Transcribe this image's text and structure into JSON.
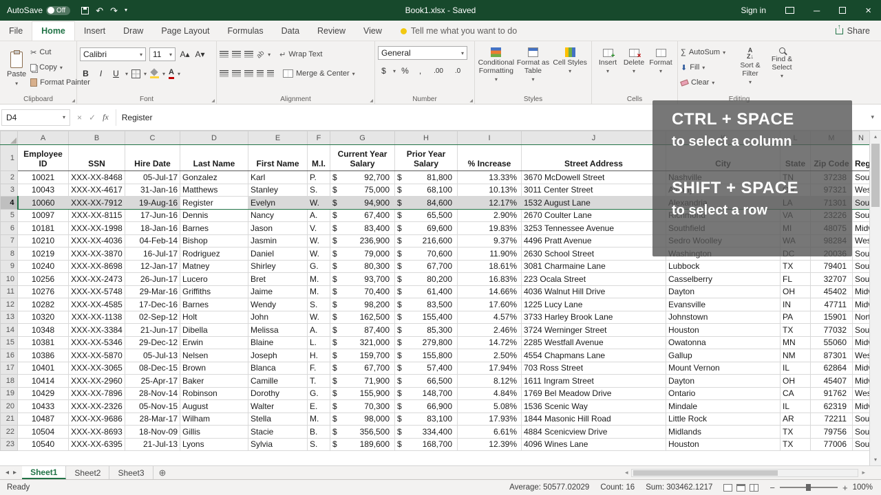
{
  "colors": {
    "excel_green": "#217346",
    "titlebar_green": "#17492c",
    "selected_row_fill": "#d9d9d9",
    "overlay_bg": "rgba(85,85,85,0.8)"
  },
  "titlebar": {
    "autosave_label": "AutoSave",
    "autosave_state": "Off",
    "title": "Book1.xlsx  -  Saved",
    "sign_in": "Sign in"
  },
  "tabs": {
    "items": [
      "File",
      "Home",
      "Insert",
      "Draw",
      "Page Layout",
      "Formulas",
      "Data",
      "Review",
      "View"
    ],
    "active": "Home",
    "tell_me": "Tell me what you want to do",
    "share": "Share"
  },
  "ribbon": {
    "clipboard": {
      "label": "Clipboard",
      "paste": "Paste",
      "cut": "Cut",
      "copy": "Copy",
      "format_painter": "Format Painter"
    },
    "font": {
      "label": "Font",
      "font_name": "Calibri",
      "font_size": "11",
      "bold": "B",
      "italic": "I",
      "underline": "U"
    },
    "alignment": {
      "label": "Alignment",
      "wrap_text": "Wrap Text",
      "merge_center": "Merge & Center"
    },
    "number": {
      "label": "Number",
      "format": "General",
      "dollar": "$",
      "percent": "%",
      "comma": ",",
      "inc_dec": ".00",
      "dec_dec": ".0"
    },
    "styles": {
      "label": "Styles",
      "conditional": "Conditional Formatting",
      "format_table": "Format as Table",
      "cell_styles": "Cell Styles"
    },
    "cells": {
      "label": "Cells",
      "insert": "Insert",
      "delete": "Delete",
      "format": "Format"
    },
    "editing": {
      "label": "Editing",
      "autosum": "AutoSum",
      "fill": "Fill",
      "clear": "Clear",
      "sort_filter": "Sort & Filter",
      "find_select": "Find & Select"
    }
  },
  "formula_bar": {
    "name_box": "D4",
    "fx_label": "fx",
    "content": "Register"
  },
  "overlay": {
    "line1": "CTRL + SPACE",
    "line2": "to select a column",
    "line3": "SHIFT + SPACE",
    "line4": "to select a row"
  },
  "sheet": {
    "col_letters": [
      "A",
      "B",
      "C",
      "D",
      "E",
      "F",
      "G",
      "H",
      "I",
      "J",
      "K",
      "L",
      "M",
      "N"
    ],
    "headers": [
      "Employee ID",
      "SSN",
      "Hire Date",
      "Last Name",
      "First Name",
      "M.I.",
      "Current Year Salary",
      "Prior Year Salary",
      "% Increase",
      "Street Address",
      "City",
      "State",
      "Zip Code",
      "Region"
    ],
    "currency": "$",
    "selected_row": 4,
    "active_col": "D",
    "rows": [
      [
        "10021",
        "XXX-XX-8468",
        "05-Jul-17",
        "Gonzalez",
        "Karl",
        "P.",
        "92,700",
        "81,800",
        "13.33%",
        "3670 McDowell Street",
        "Nashville",
        "TN",
        "37238",
        "South"
      ],
      [
        "10043",
        "XXX-XX-4617",
        "31-Jan-16",
        "Matthews",
        "Stanley",
        "S.",
        "75,000",
        "68,100",
        "10.13%",
        "3011 Center Street",
        "Albany",
        "OR",
        "97321",
        "West"
      ],
      [
        "10060",
        "XXX-XX-7912",
        "19-Aug-16",
        "Register",
        "Evelyn",
        "W.",
        "94,900",
        "84,600",
        "12.17%",
        "1532 August Lane",
        "Alexandria",
        "LA",
        "71301",
        "South"
      ],
      [
        "10097",
        "XXX-XX-8115",
        "17-Jun-16",
        "Dennis",
        "Nancy",
        "A.",
        "67,400",
        "65,500",
        "2.90%",
        "2670 Coulter Lane",
        "Richmond",
        "VA",
        "23226",
        "South"
      ],
      [
        "10181",
        "XXX-XX-1998",
        "18-Jan-16",
        "Barnes",
        "Jason",
        "V.",
        "83,400",
        "69,600",
        "19.83%",
        "3253 Tennessee Avenue",
        "Southfield",
        "MI",
        "48075",
        "Midwest"
      ],
      [
        "10210",
        "XXX-XX-4036",
        "04-Feb-14",
        "Bishop",
        "Jasmin",
        "W.",
        "236,900",
        "216,600",
        "9.37%",
        "4496 Pratt Avenue",
        "Sedro Woolley",
        "WA",
        "98284",
        "West"
      ],
      [
        "10219",
        "XXX-XX-3870",
        "16-Jul-17",
        "Rodriguez",
        "Daniel",
        "W.",
        "79,000",
        "70,600",
        "11.90%",
        "2630 School Street",
        "Washington",
        "DC",
        "20036",
        "South"
      ],
      [
        "10240",
        "XXX-XX-8698",
        "12-Jan-17",
        "Matney",
        "Shirley",
        "G.",
        "80,300",
        "67,700",
        "18.61%",
        "3081 Charmaine Lane",
        "Lubbock",
        "TX",
        "79401",
        "South"
      ],
      [
        "10256",
        "XXX-XX-2473",
        "26-Jun-17",
        "Lucero",
        "Bret",
        "M.",
        "93,700",
        "80,200",
        "16.83%",
        "223 Ocala Street",
        "Casselberry",
        "FL",
        "32707",
        "South"
      ],
      [
        "10276",
        "XXX-XX-5748",
        "29-Mar-16",
        "Griffiths",
        "Jaime",
        "M.",
        "70,400",
        "61,400",
        "14.66%",
        "4036 Walnut Hill Drive",
        "Dayton",
        "OH",
        "45402",
        "Midwest"
      ],
      [
        "10282",
        "XXX-XX-4585",
        "17-Dec-16",
        "Barnes",
        "Wendy",
        "S.",
        "98,200",
        "83,500",
        "17.60%",
        "1225 Lucy Lane",
        "Evansville",
        "IN",
        "47711",
        "Midwest"
      ],
      [
        "10320",
        "XXX-XX-1138",
        "02-Sep-12",
        "Holt",
        "John",
        "W.",
        "162,500",
        "155,400",
        "4.57%",
        "3733 Harley Brook Lane",
        "Johnstown",
        "PA",
        "15901",
        "Northeast"
      ],
      [
        "10348",
        "XXX-XX-3384",
        "21-Jun-17",
        "Dibella",
        "Melissa",
        "A.",
        "87,400",
        "85,300",
        "2.46%",
        "3724 Werninger Street",
        "Houston",
        "TX",
        "77032",
        "South"
      ],
      [
        "10381",
        "XXX-XX-5346",
        "29-Dec-12",
        "Erwin",
        "Blaine",
        "L.",
        "321,000",
        "279,800",
        "14.72%",
        "2285 Westfall Avenue",
        "Owatonna",
        "MN",
        "55060",
        "Midwest"
      ],
      [
        "10386",
        "XXX-XX-5870",
        "05-Jul-13",
        "Nelsen",
        "Joseph",
        "H.",
        "159,700",
        "155,800",
        "2.50%",
        "4554 Chapmans Lane",
        "Gallup",
        "NM",
        "87301",
        "West"
      ],
      [
        "10401",
        "XXX-XX-3065",
        "08-Dec-15",
        "Brown",
        "Blanca",
        "F.",
        "67,700",
        "57,400",
        "17.94%",
        "703 Ross Street",
        "Mount Vernon",
        "IL",
        "62864",
        "Midwest"
      ],
      [
        "10414",
        "XXX-XX-2960",
        "25-Apr-17",
        "Baker",
        "Camille",
        "T.",
        "71,900",
        "66,500",
        "8.12%",
        "1611 Ingram Street",
        "Dayton",
        "OH",
        "45407",
        "Midwest"
      ],
      [
        "10429",
        "XXX-XX-7896",
        "28-Nov-14",
        "Robinson",
        "Dorothy",
        "G.",
        "155,900",
        "148,700",
        "4.84%",
        "1769 Bel Meadow Drive",
        "Ontario",
        "CA",
        "91762",
        "West"
      ],
      [
        "10433",
        "XXX-XX-2326",
        "05-Nov-15",
        "August",
        "Walter",
        "E.",
        "70,300",
        "66,900",
        "5.08%",
        "1536 Scenic Way",
        "Mindale",
        "IL",
        "62319",
        "Midwest"
      ],
      [
        "10487",
        "XXX-XX-9686",
        "28-Mar-17",
        "Wilham",
        "Stella",
        "M.",
        "98,000",
        "83,100",
        "17.93%",
        "1844 Masonic Hill Road",
        "Little Rock",
        "AR",
        "72211",
        "South"
      ],
      [
        "10504",
        "XXX-XX-8693",
        "18-Nov-09",
        "Gillis",
        "Stacie",
        "B.",
        "356,500",
        "334,400",
        "6.61%",
        "4884 Scenicview Drive",
        "Midlands",
        "TX",
        "79756",
        "South"
      ],
      [
        "10540",
        "XXX-XX-6395",
        "21-Jul-13",
        "Lyons",
        "Sylvia",
        "S.",
        "189,600",
        "168,700",
        "12.39%",
        "4096 Wines Lane",
        "Houston",
        "TX",
        "77006",
        "South"
      ]
    ]
  },
  "sheet_tabs": {
    "items": [
      "Sheet1",
      "Sheet2",
      "Sheet3"
    ],
    "active": "Sheet1"
  },
  "status_bar": {
    "ready": "Ready",
    "average": "Average: 50577.02029",
    "count": "Count: 16",
    "sum": "Sum: 303462.1217",
    "zoom": "100%"
  }
}
